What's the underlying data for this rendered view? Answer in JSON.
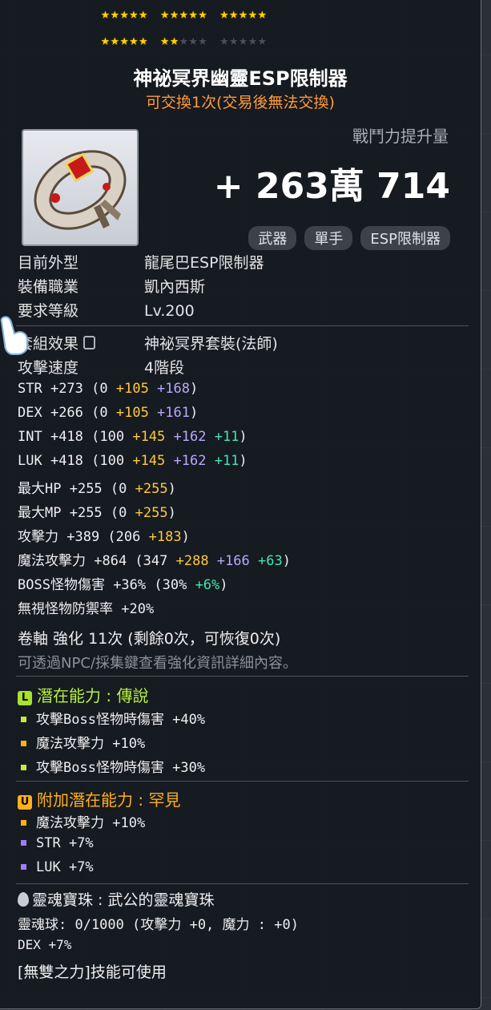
{
  "stars": {
    "row1": [
      5,
      5,
      5
    ],
    "row2_filled": [
      5,
      2,
      0
    ],
    "group_size": 5
  },
  "item": {
    "name": "神祕冥界幽靈ESP限制器",
    "trade_note": "可交換1次(交易後無法交換)",
    "icon": "esp-limiter-bracelet-icon"
  },
  "power": {
    "label": "戰鬥力提升量",
    "value": "+ 263萬 714"
  },
  "tags": [
    "武器",
    "單手",
    "ESP限制器"
  ],
  "info": [
    {
      "label": "目前外型",
      "value": "龍尾巴ESP限制器"
    },
    {
      "label": "裝備職業",
      "value": "凱內西斯"
    },
    {
      "label": "要求等級",
      "value": "Lv.200"
    }
  ],
  "set_effect": {
    "label": "套組效果",
    "value": "神祕冥界套裝(法師)"
  },
  "attack_speed": {
    "label": "攻擊速度",
    "value": "4階段"
  },
  "stats": [
    {
      "name": "STR",
      "total": "+273",
      "base": "(0",
      "flame": "+105",
      "star": "+168",
      "extra": "",
      "close": ")"
    },
    {
      "name": "DEX",
      "total": "+266",
      "base": "(0",
      "flame": "+105",
      "star": "+161",
      "extra": "",
      "close": ")"
    },
    {
      "name": "INT",
      "total": "+418",
      "base": "(100",
      "flame": "+145",
      "star": "+162",
      "extra": "+11",
      "close": ")"
    },
    {
      "name": "LUK",
      "total": "+418",
      "base": "(100",
      "flame": "+145",
      "star": "+162",
      "extra": "+11",
      "close": ")"
    },
    {
      "name": "最大HP",
      "total": "+255",
      "base": "(0",
      "flame": "+255",
      "star": "",
      "extra": "",
      "close": ")"
    },
    {
      "name": "最大MP",
      "total": "+255",
      "base": "(0",
      "flame": "+255",
      "star": "",
      "extra": "",
      "close": ")"
    },
    {
      "name": "攻擊力",
      "total": "+389",
      "base": "(206",
      "flame": "+183",
      "star": "",
      "extra": "",
      "close": ")"
    },
    {
      "name": "魔法攻擊力",
      "total": "+864",
      "base": "(347",
      "flame": "+288",
      "star": "+166",
      "extra": "+63",
      "close": ")"
    },
    {
      "name": "BOSS怪物傷害",
      "total": "+36%",
      "base": "(30%",
      "flame": "",
      "star": "",
      "extra": "+6%",
      "close": ")"
    },
    {
      "name": "無視怪物防禦率",
      "total": "+20%",
      "base": "",
      "flame": "",
      "star": "",
      "extra": "",
      "close": ""
    }
  ],
  "scroll": {
    "line": "卷軸 強化 11次 (剩餘0次，可恢復0次)",
    "hint": "可透過NPC/採集鍵查看強化資訊詳細內容。"
  },
  "potential": {
    "header": "潛在能力 : 傳說",
    "badge": "L",
    "lines": [
      {
        "text": "攻擊Boss怪物時傷害 +40%",
        "tier": "legendary"
      },
      {
        "text": "魔法攻擊力 +10%",
        "tier": "unique"
      },
      {
        "text": "攻擊Boss怪物時傷害 +30%",
        "tier": "legendary"
      }
    ]
  },
  "additional": {
    "header": "附加潛在能力 : 罕見",
    "badge": "U",
    "lines": [
      {
        "text": "魔法攻擊力 +10%",
        "tier": "unique"
      },
      {
        "text": "STR +7%",
        "tier": "epic"
      },
      {
        "text": "LUK +7%",
        "tier": "epic"
      }
    ]
  },
  "soul": {
    "title": "靈魂寶珠 : 武公的靈魂寶珠",
    "charge": "靈魂球: 0/1000 (攻擊力 +0, 魔力 : +0)",
    "bonus": "DEX +7%",
    "skill": "[無雙之力]技能可使用"
  },
  "colors": {
    "flame": "#ffc93a",
    "star": "#b8a8ff",
    "extra": "#44e6b0",
    "legendary": "#b8f23c",
    "unique": "#ffb019",
    "epic": "#a07cff"
  }
}
